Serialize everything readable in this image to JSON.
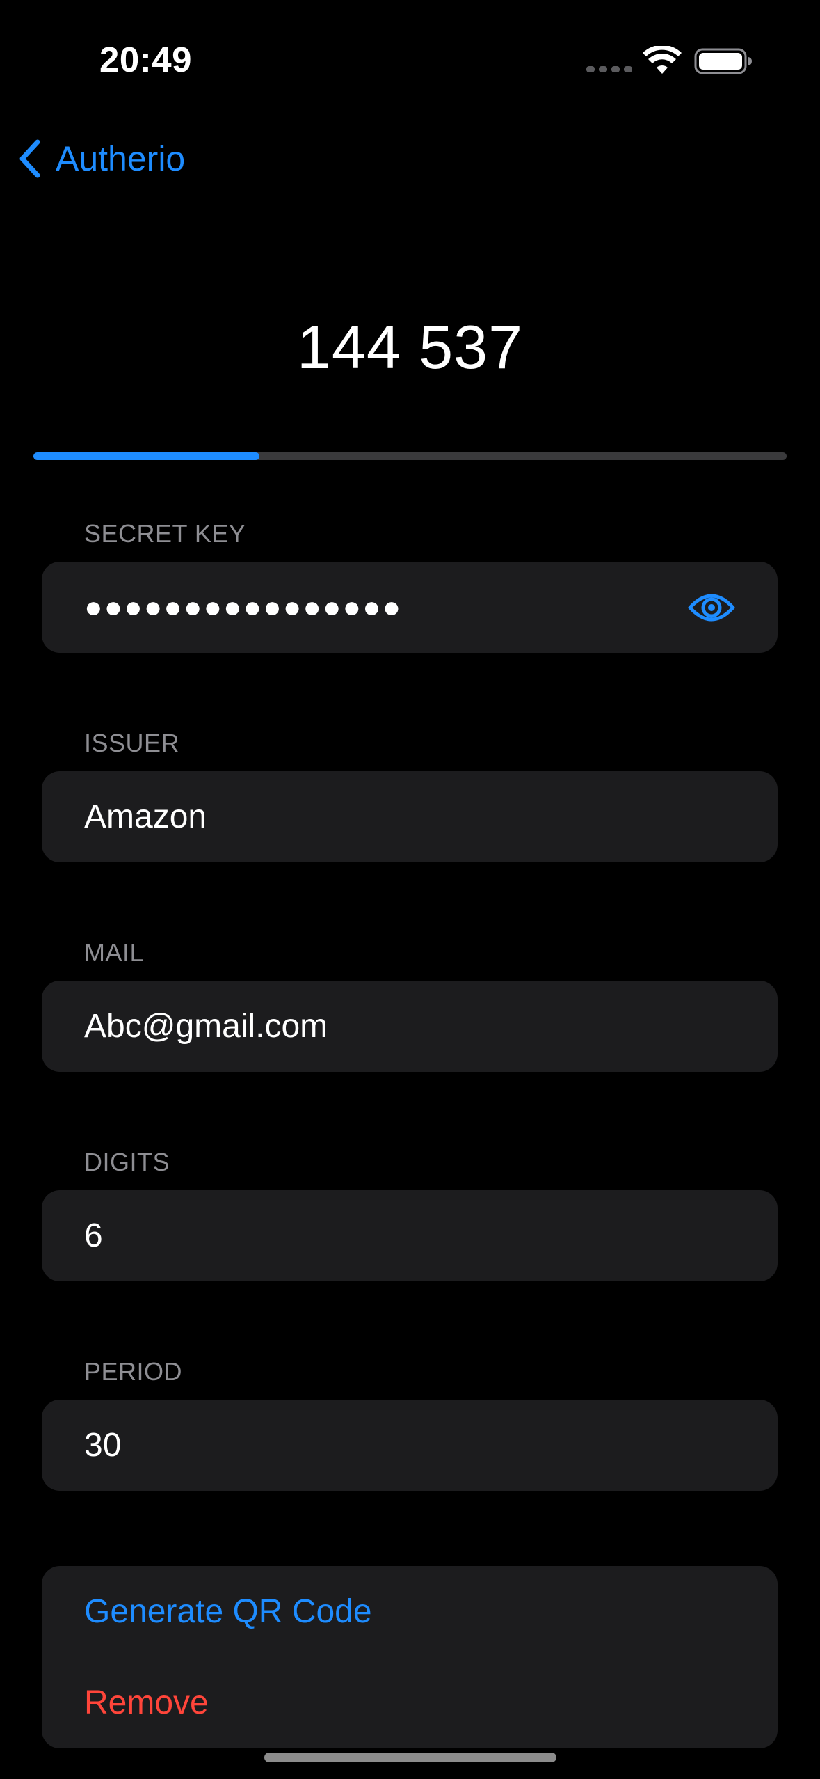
{
  "status_bar": {
    "time": "20:49",
    "signal_icon": "cellular-signal-icon",
    "wifi_icon": "wifi-icon",
    "battery_icon": "battery-icon"
  },
  "navigation": {
    "back_icon": "chevron-left-icon",
    "back_label": "Autherio"
  },
  "otp": {
    "code": "144 537",
    "progress_fraction": 0.3
  },
  "fields": {
    "secret_key": {
      "label": "SECRET KEY",
      "value": "●●●●●●●●●●●●●●●●",
      "toggle_icon": "eye-icon"
    },
    "issuer": {
      "label": "ISSUER",
      "value": "Amazon"
    },
    "mail": {
      "label": "MAIL",
      "value": "Abc@gmail.com"
    },
    "digits": {
      "label": "DIGITS",
      "value": "6"
    },
    "period": {
      "label": "PERIOD",
      "value": "30"
    }
  },
  "actions": {
    "generate_qr_label": "Generate QR Code",
    "remove_label": "Remove"
  },
  "colors": {
    "accent": "#1e8cff",
    "destructive": "#ff453a",
    "background": "#000000",
    "field_background": "#1c1c1e",
    "secondary_text": "#8e8e93"
  }
}
